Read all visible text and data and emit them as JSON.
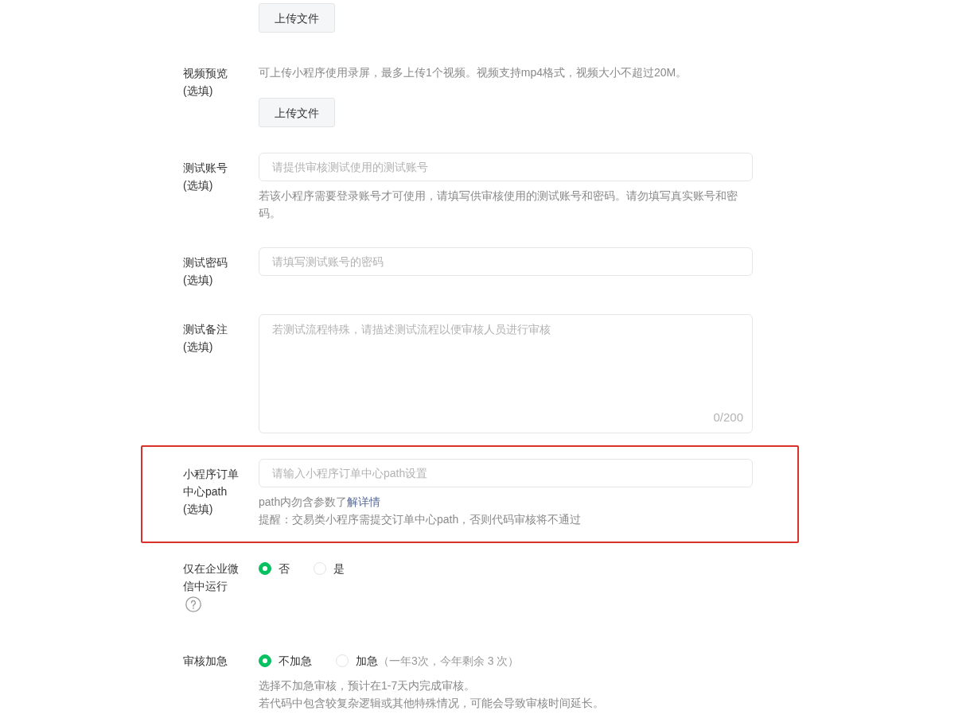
{
  "rows": [
    {
      "kind": "upload",
      "highlighted": false,
      "button": "上传文件"
    },
    {
      "kind": "upload",
      "highlighted": false,
      "label": "视频预览",
      "optional": "(选填)",
      "description": "可上传小程序使用录屏，最多上传1个视频。视频支持mp4格式，视频大小不超过20M。",
      "button": "上传文件"
    },
    {
      "kind": "input",
      "highlighted": false,
      "label": "测试账号",
      "optional": "(选填)",
      "placeholder": "请提供审核测试使用的测试账号",
      "hints": [
        {
          "text": "若该小程序需要登录账号才可使用，请填写供审核使用的测试账号和密码。请勿填写真实账号和密码。"
        }
      ]
    },
    {
      "kind": "input",
      "highlighted": false,
      "label": "测试密码",
      "optional": "(选填)",
      "placeholder": "请填写测试账号的密码"
    },
    {
      "kind": "textarea",
      "highlighted": false,
      "label": "测试备注",
      "optional": "(选填)",
      "placeholder": "若测试流程特殊，请描述测试流程以便审核人员进行审核",
      "counter": "0/200"
    },
    {
      "kind": "input",
      "highlighted": true,
      "label": "小程序订单中心path",
      "optional": "(选填)",
      "placeholder": "请输入小程序订单中心path设置",
      "hints": [
        {
          "text": "path内勿含参数了",
          "link": "解详情"
        },
        {
          "text": "提醒：交易类小程序需提交订单中心path，否则代码审核将不通过"
        }
      ]
    },
    {
      "kind": "radio",
      "highlighted": false,
      "label": "仅在企业微信中运行",
      "help": true,
      "options": [
        {
          "label": "否",
          "selected": true
        },
        {
          "label": "是",
          "selected": false
        }
      ]
    },
    {
      "kind": "radio",
      "highlighted": false,
      "label": "审核加急",
      "options": [
        {
          "label": "不加急",
          "selected": true
        },
        {
          "label": "加急",
          "note": "（一年3次，今年剩余 3 次）",
          "selected": false
        }
      ],
      "hints": [
        {
          "text": "选择不加急审核，预计在1-7天内完成审核。"
        },
        {
          "text": "若代码中包含较复杂逻辑或其他特殊情况，可能会导致审核时间延长。"
        }
      ]
    }
  ]
}
